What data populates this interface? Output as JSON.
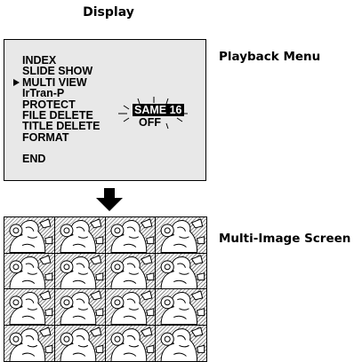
{
  "heading": "Display",
  "menu": {
    "items": [
      "INDEX",
      "SLIDE  SHOW",
      "MULTI  VIEW",
      "IrTran-P",
      "PROTECT",
      "FILE  DELETE",
      "TITLE  DELETE",
      "FORMAT"
    ],
    "end_label": "END",
    "selected_index": 2,
    "options": {
      "same_label": "SAME",
      "same_value": "16",
      "off_label": "OFF"
    }
  },
  "labels": {
    "playback_menu": "Playback Menu",
    "multi_image": "Multi-Image Screen"
  },
  "multi_image": {
    "rows": 4,
    "columns": 4
  }
}
